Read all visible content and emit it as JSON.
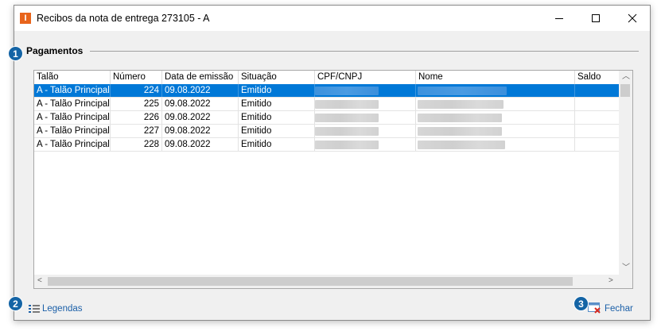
{
  "window": {
    "title": "Recibos da nota de entrega 273105 - A",
    "app_icon_glyph": "I",
    "controls": [
      "minimize",
      "maximize",
      "close"
    ]
  },
  "group": {
    "label": "Pagamentos"
  },
  "table": {
    "columns": [
      "Talão",
      "Número",
      "Data de emissão",
      "Situação",
      "CPF/CNPJ",
      "Nome",
      "Saldo"
    ],
    "rows": [
      {
        "talao": "A - Talão Principal",
        "numero": "224",
        "data": "09.08.2022",
        "situacao": "Emitido",
        "selected": true
      },
      {
        "talao": "A - Talão Principal",
        "numero": "225",
        "data": "09.08.2022",
        "situacao": "Emitido",
        "selected": false
      },
      {
        "talao": "A - Talão Principal",
        "numero": "226",
        "data": "09.08.2022",
        "situacao": "Emitido",
        "selected": false
      },
      {
        "talao": "A - Talão Principal",
        "numero": "227",
        "data": "09.08.2022",
        "situacao": "Emitido",
        "selected": false
      },
      {
        "talao": "A - Talão Principal",
        "numero": "228",
        "data": "09.08.2022",
        "situacao": "Emitido",
        "selected": false
      }
    ]
  },
  "footer": {
    "legend_label": "Legendas",
    "close_label": "Fechar"
  },
  "badges": [
    "1",
    "2",
    "3"
  ],
  "colors": {
    "accent": "#0078d7",
    "badge": "#1464a5",
    "link": "#1a5fa8",
    "app_icon": "#e8641b"
  }
}
